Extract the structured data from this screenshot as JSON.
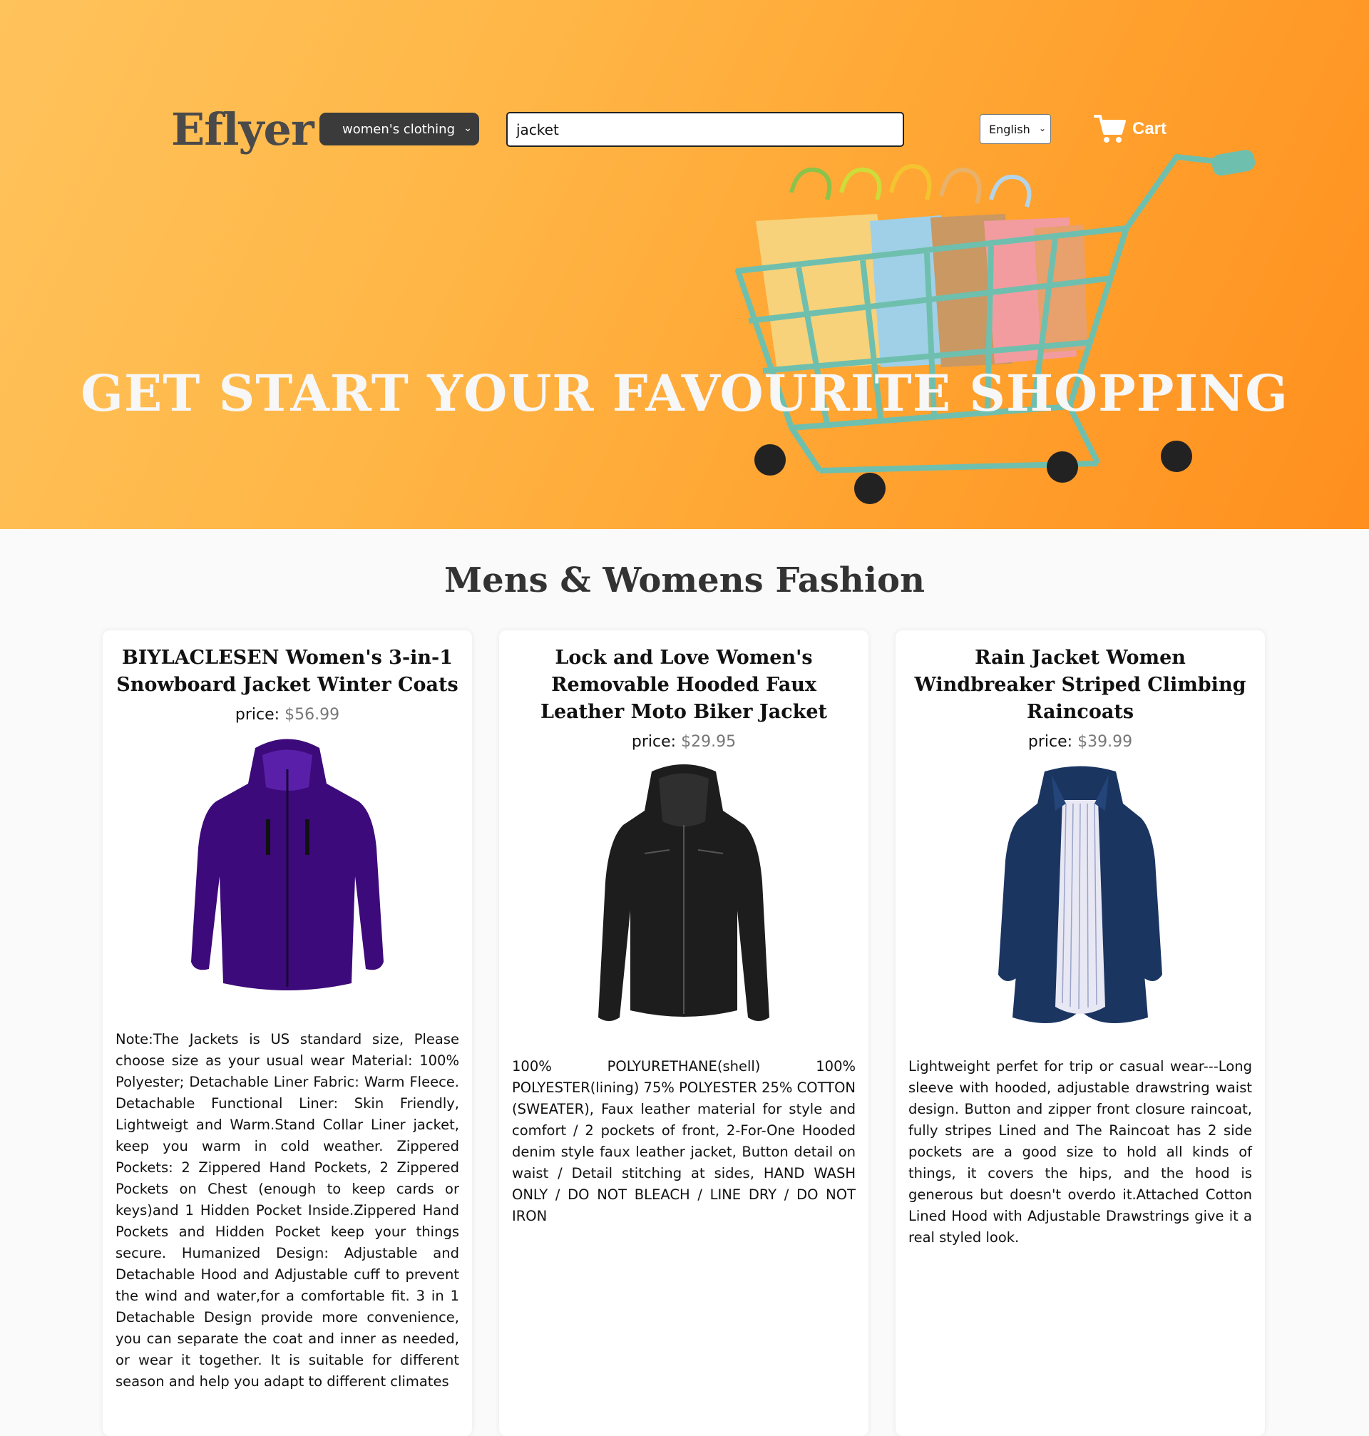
{
  "header": {
    "logo": "Eflyer",
    "category_selected": "women's clothing",
    "search_value": "jacket",
    "language_selected": "English",
    "cart_label": "Cart"
  },
  "hero": {
    "title": "GET START YOUR FAVOURITE SHOPPING"
  },
  "section": {
    "title": "Mens & Womens Fashion",
    "price_label": "price:",
    "products": [
      {
        "title": "BIYLACLESEN Women's 3-in-1 Snowboard Jacket Winter Coats",
        "price": "$56.99",
        "description": "Note:The Jackets is US standard size, Please choose size as your usual wear Material: 100% Polyester; Detachable Liner Fabric: Warm Fleece. Detachable Functional Liner: Skin Friendly, Lightweigt and Warm.Stand Collar Liner jacket, keep you warm in cold weather. Zippered Pockets: 2 Zippered Hand Pockets, 2 Zippered Pockets on Chest (enough to keep cards or keys)and 1 Hidden Pocket Inside.Zippered Hand Pockets and Hidden Pocket keep your things secure. Humanized Design: Adjustable and Detachable Hood and Adjustable cuff to prevent the wind and water,for a comfortable fit. 3 in 1 Detachable Design provide more convenience, you can separate the coat and inner as needed, or wear it together. It is suitable for different season and help you adapt to different climates"
      },
      {
        "title": "Lock and Love Women's Removable Hooded Faux Leather Moto Biker Jacket",
        "price": "$29.95",
        "description": "100% POLYURETHANE(shell) 100% POLYESTER(lining) 75% POLYESTER 25% COTTON (SWEATER), Faux leather material for style and comfort / 2 pockets of front, 2-For-One Hooded denim style faux leather jacket, Button detail on waist / Detail stitching at sides, HAND WASH ONLY / DO NOT BLEACH / LINE DRY / DO NOT IRON"
      },
      {
        "title": "Rain Jacket Women Windbreaker Striped Climbing Raincoats",
        "price": "$39.99",
        "description": "Lightweight perfet for trip or casual wear---Long sleeve with hooded, adjustable drawstring waist design. Button and zipper front closure raincoat, fully stripes Lined and The Raincoat has 2 side pockets are a good size to hold all kinds of things, it covers the hips, and the hood is generous but doesn't overdo it.Attached Cotton Lined Hood with Adjustable Drawstrings give it a real styled look."
      }
    ]
  },
  "icons": {
    "cart": "shopping-cart-icon",
    "select_arrow": "chevron-down-icon"
  },
  "colors": {
    "hero_orange": "#ffa12e",
    "select_bg": "#3b3b3b",
    "price_gray": "#777777"
  }
}
